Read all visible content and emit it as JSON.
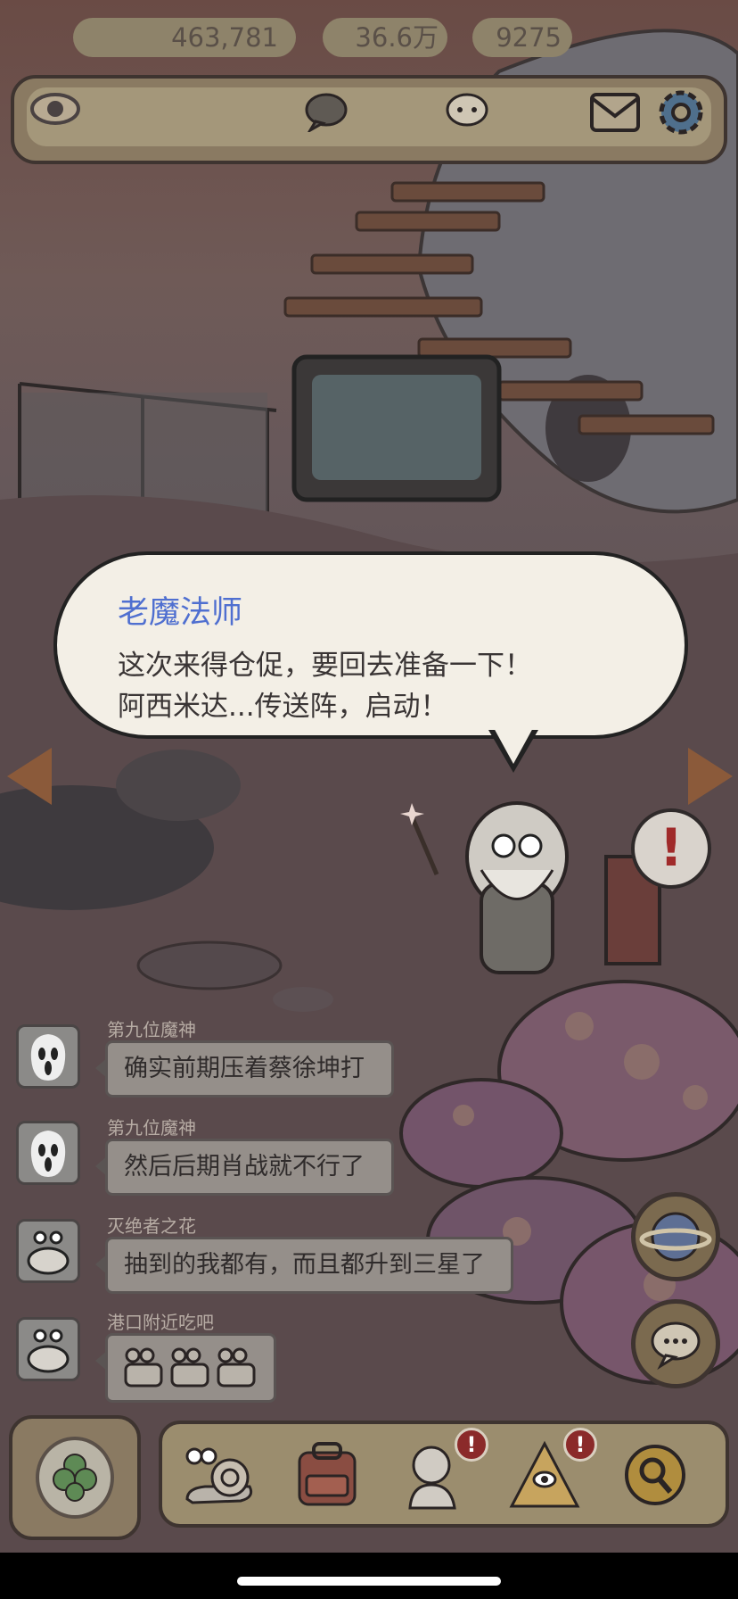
{
  "stats": {
    "views": "463,781",
    "comments": "36.6万",
    "messages": "9275"
  },
  "dialog": {
    "speaker": "老魔法师",
    "line1": "这次来得仓促，要回去准备一下！",
    "line2": "阿西米达...传送阵，启动！"
  },
  "chat": [
    {
      "name": "第九位魔神",
      "text": "确实前期压着蔡徐坤打",
      "avatar": "ghostface-avatar"
    },
    {
      "name": "第九位魔神",
      "text": "然后后期肖战就不行了",
      "avatar": "ghostface-avatar"
    },
    {
      "name": "灭绝者之花",
      "text": "抽到的我都有，而且都升到三星了",
      "avatar": "snail-avatar"
    },
    {
      "name": "港口附近吃吧",
      "text": "",
      "avatar": "snail-avatar"
    }
  ],
  "badges": {
    "statue": "!",
    "pyramid": "!"
  },
  "alert_mark": "!",
  "colors": {
    "speaker_name": "#4f6fd0",
    "badge": "#8b2a2a",
    "bar": "#9b8d6e"
  }
}
